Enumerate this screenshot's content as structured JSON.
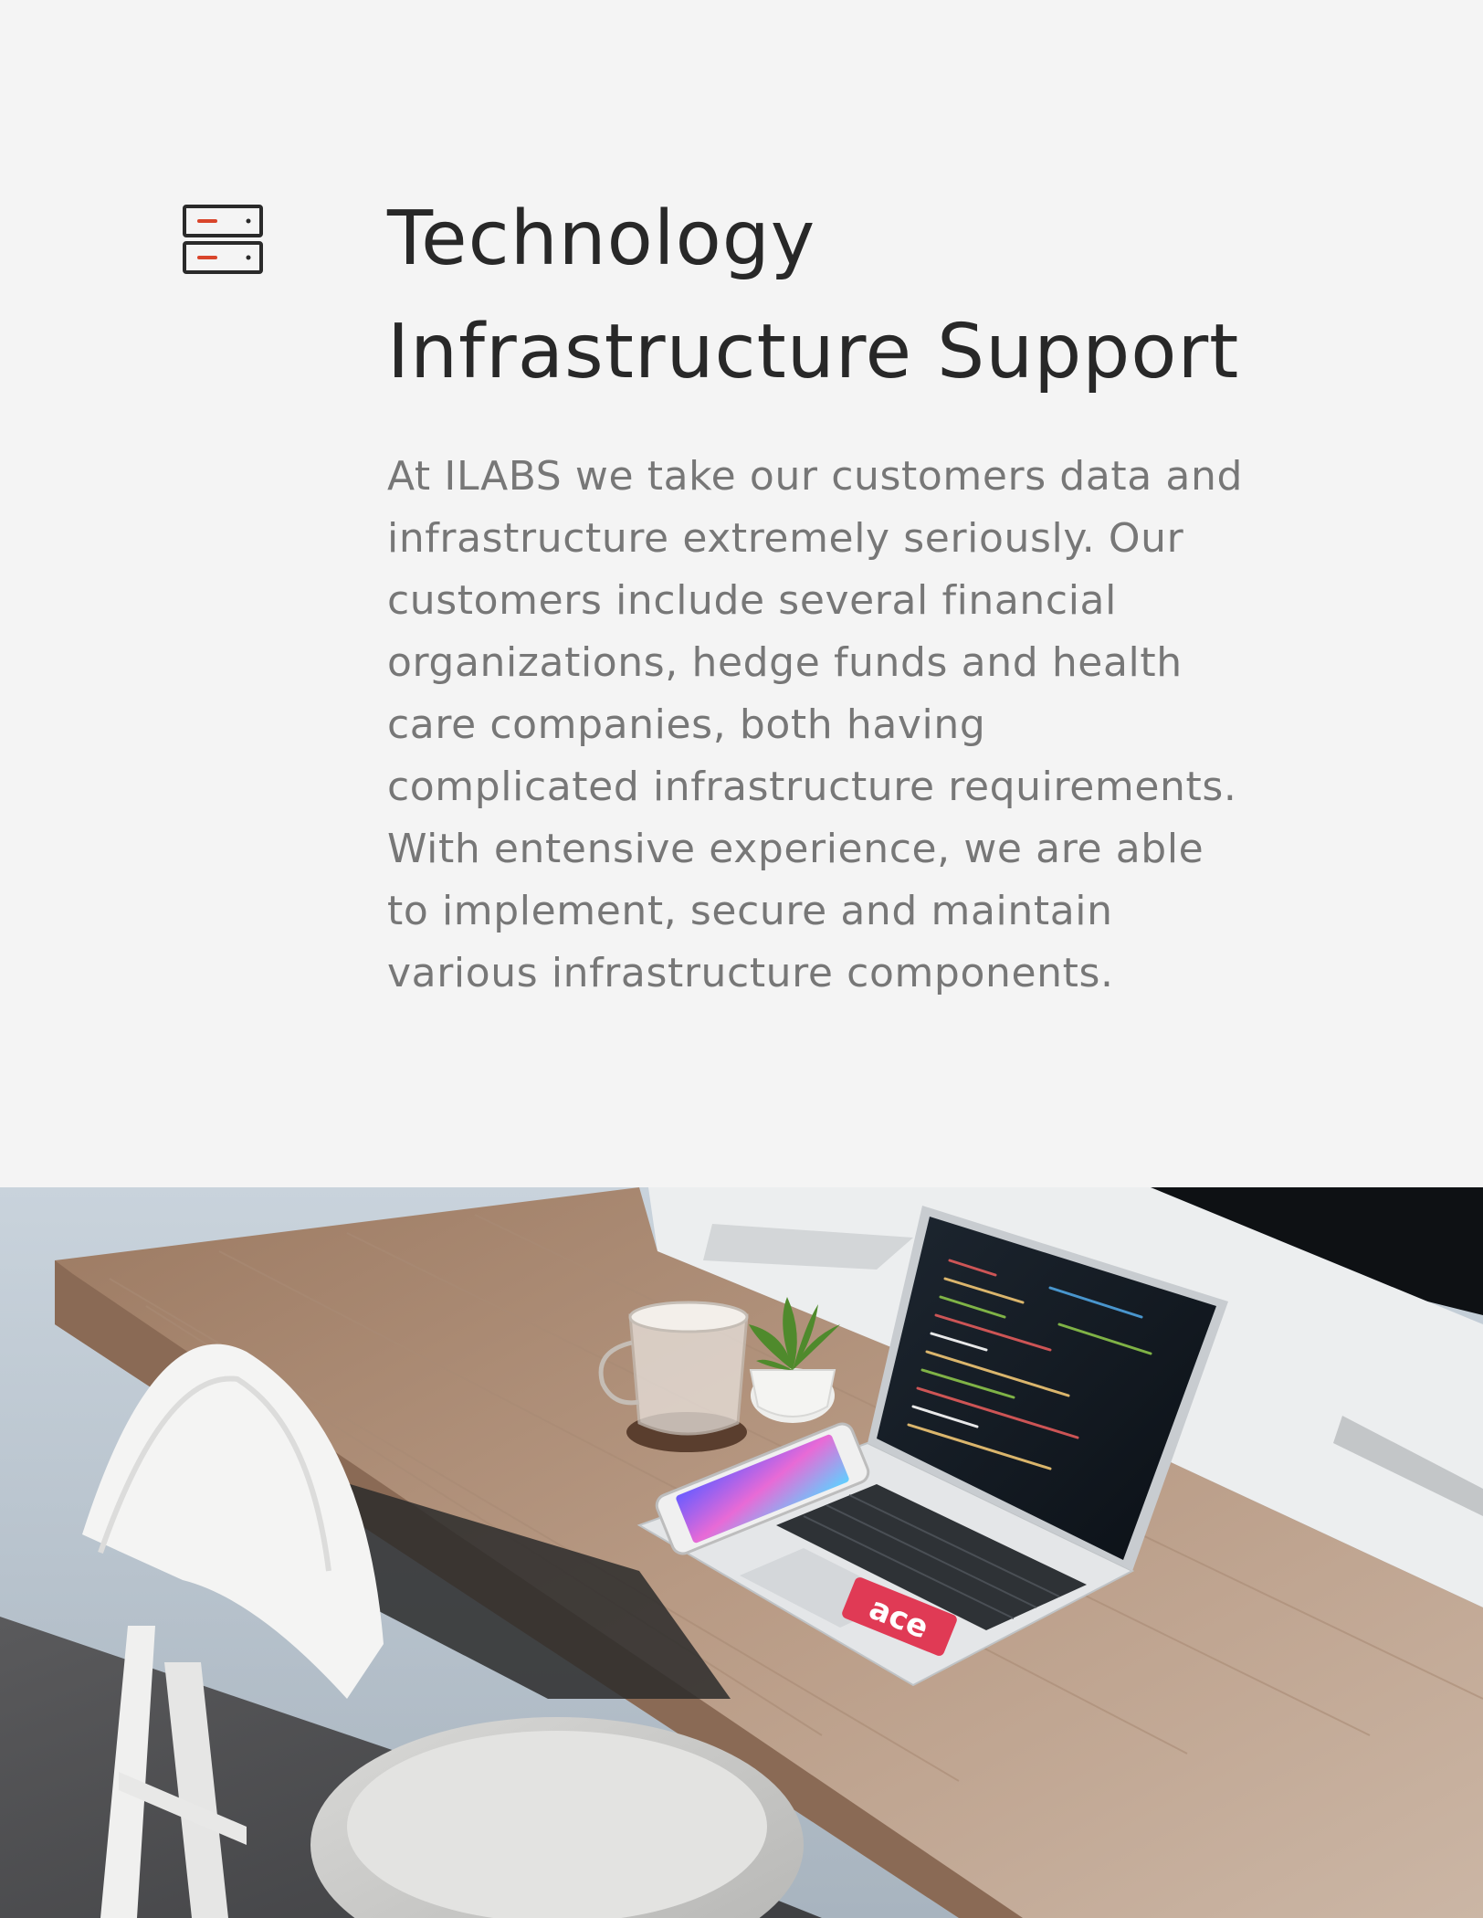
{
  "section": {
    "icon": "server-stack-icon",
    "accent_color": "#d9452b",
    "title_lines": [
      "Technology",
      "Infrastructure Support"
    ],
    "description_lines": [
      "At ILABS we take our customers data and",
      "infrastructure extremely seriously. Our",
      "customers include several financial",
      "organizations, hedge funds and health",
      "care companies, both having",
      "complicated infrastructure requirements.",
      "With entensive experience, we are able",
      "to implement, secure and maintain",
      "various infrastructure components."
    ]
  },
  "photo": {
    "subject": "workspace-photo",
    "laptop_sticker": "ace"
  }
}
